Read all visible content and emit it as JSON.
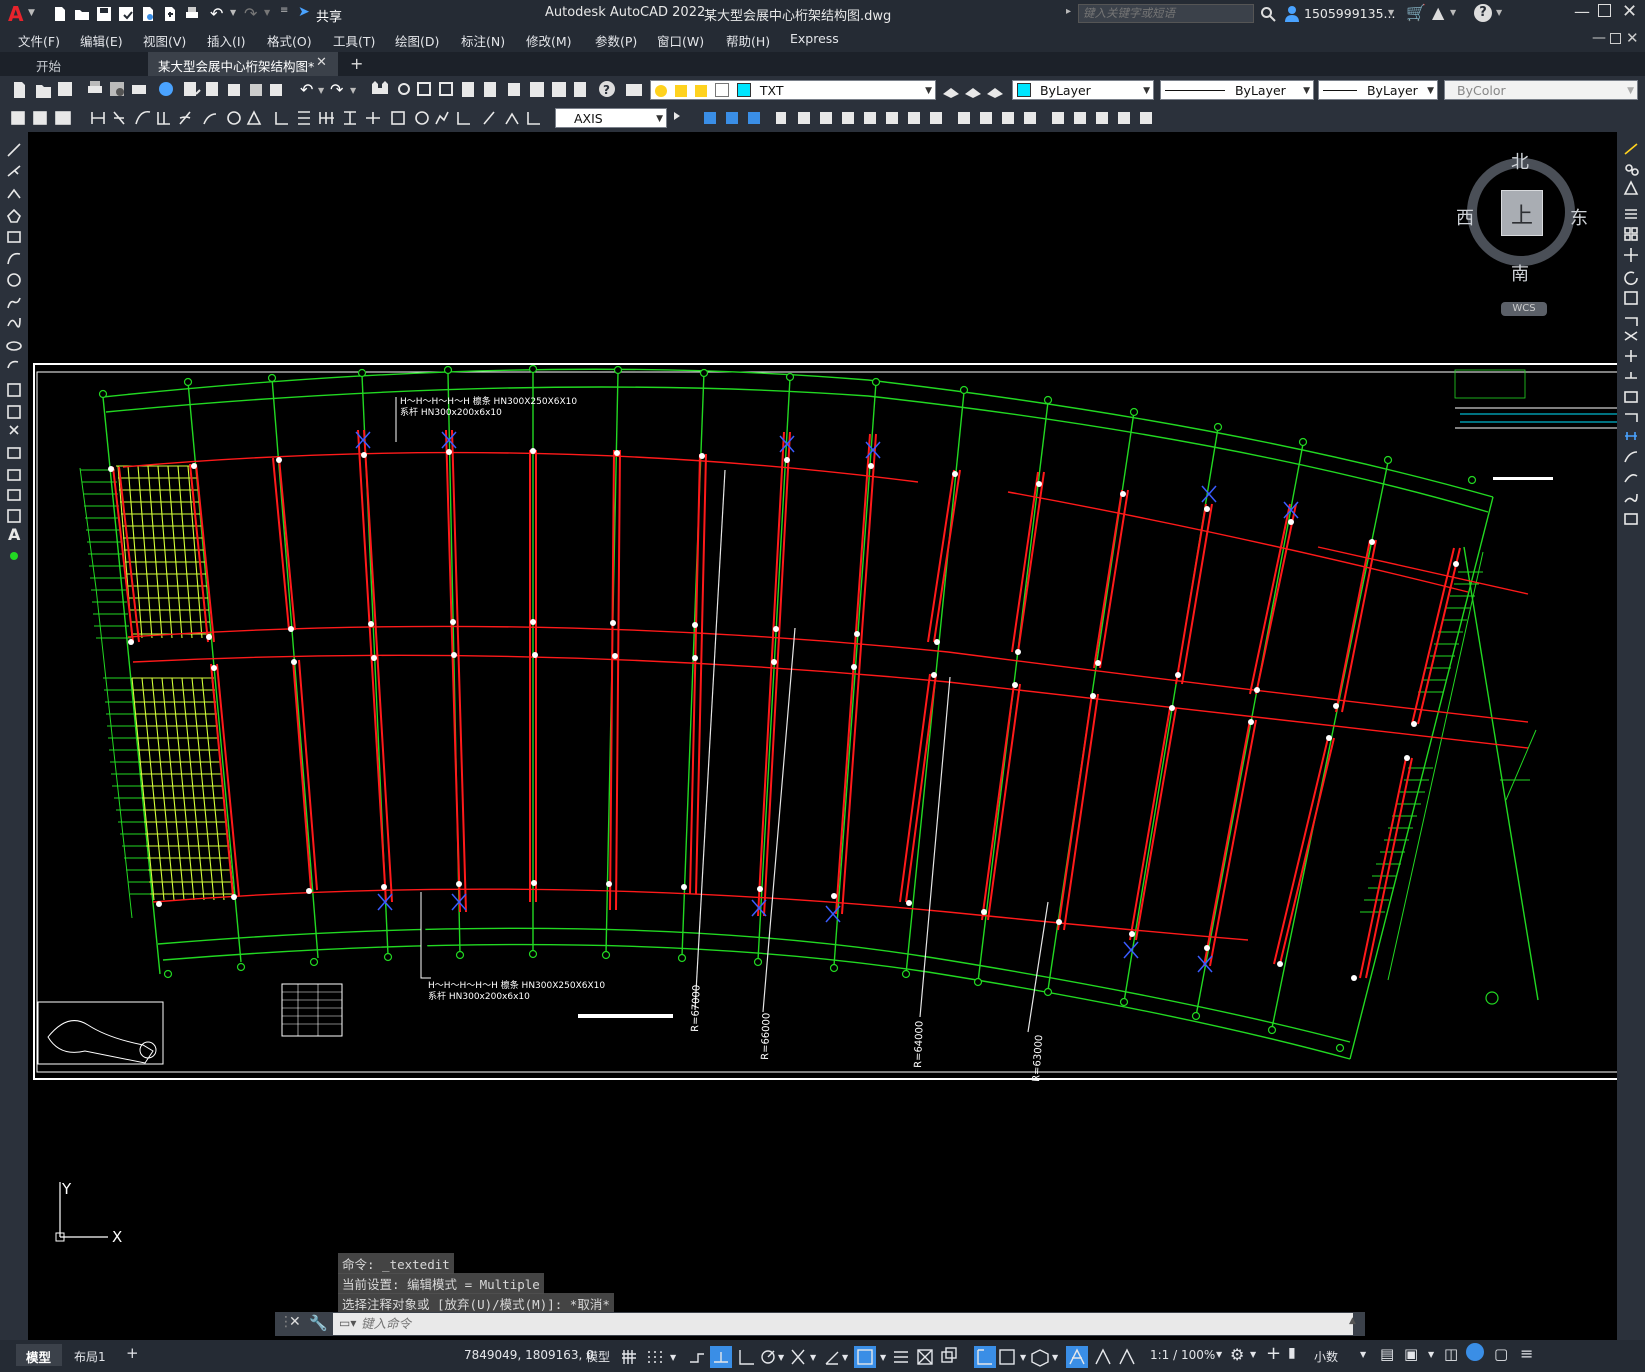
{
  "app": {
    "title": "Autodesk AutoCAD 2022",
    "file": "某大型会展中心桁架结构图.dwg",
    "search_placeholder": "键入关键字或短语",
    "user": "1505999135...",
    "share": "共享",
    "logo": "A"
  },
  "menu": [
    "文件(F)",
    "编辑(E)",
    "视图(V)",
    "插入(I)",
    "格式(O)",
    "工具(T)",
    "绘图(D)",
    "标注(N)",
    "修改(M)",
    "参数(P)",
    "窗口(W)",
    "帮助(H)",
    "Express"
  ],
  "tabs": {
    "start": "开始",
    "active": "某大型会展中心桁架结构图*",
    "add": "+"
  },
  "properties": {
    "layer": "TXT",
    "color": "ByLayer",
    "linetype": "ByLayer",
    "lineweight": "ByLayer",
    "plotstyle": "ByColor",
    "dimstyle": "AXIS",
    "layer_color": "#00e5ff"
  },
  "viewcube": {
    "north": "北",
    "south": "南",
    "east": "东",
    "west": "西",
    "top": "上",
    "wcs": "WCS"
  },
  "drawing": {
    "member_label_top": "H～H～H～H～H 檩条 HN300X250X6X10",
    "member_label_top2": "系杆 HN300x200x6x10",
    "member_label_bottom": "H～H～H～H～H 檩条 HN300X250X6X10",
    "member_label_bottom2": "系杆 HN300x200x6x10",
    "radius_1": "R=67000",
    "radius_2": "R=66000",
    "radius_3": "R=64000",
    "radius_4": "R=63000",
    "colors": {
      "axis": "#22d822",
      "beam": "#ff1a1a",
      "frame": "#ffffff",
      "mesh": "#d4ff3a"
    }
  },
  "ucs": {
    "x": "X",
    "y": "Y"
  },
  "command": {
    "history": [
      "命令: _textedit",
      "当前设置: 编辑模式 = Multiple",
      "选择注释对象或 [放弃(U)/模式(M)]: *取消*"
    ],
    "placeholder": "键入命令"
  },
  "layout_tabs": {
    "model": "模型",
    "layout1": "布局1",
    "add": "+"
  },
  "status": {
    "coords": "7849049, 1809163, 0",
    "model": "模型",
    "scale": "1:1 / 100%",
    "units": "小数"
  }
}
